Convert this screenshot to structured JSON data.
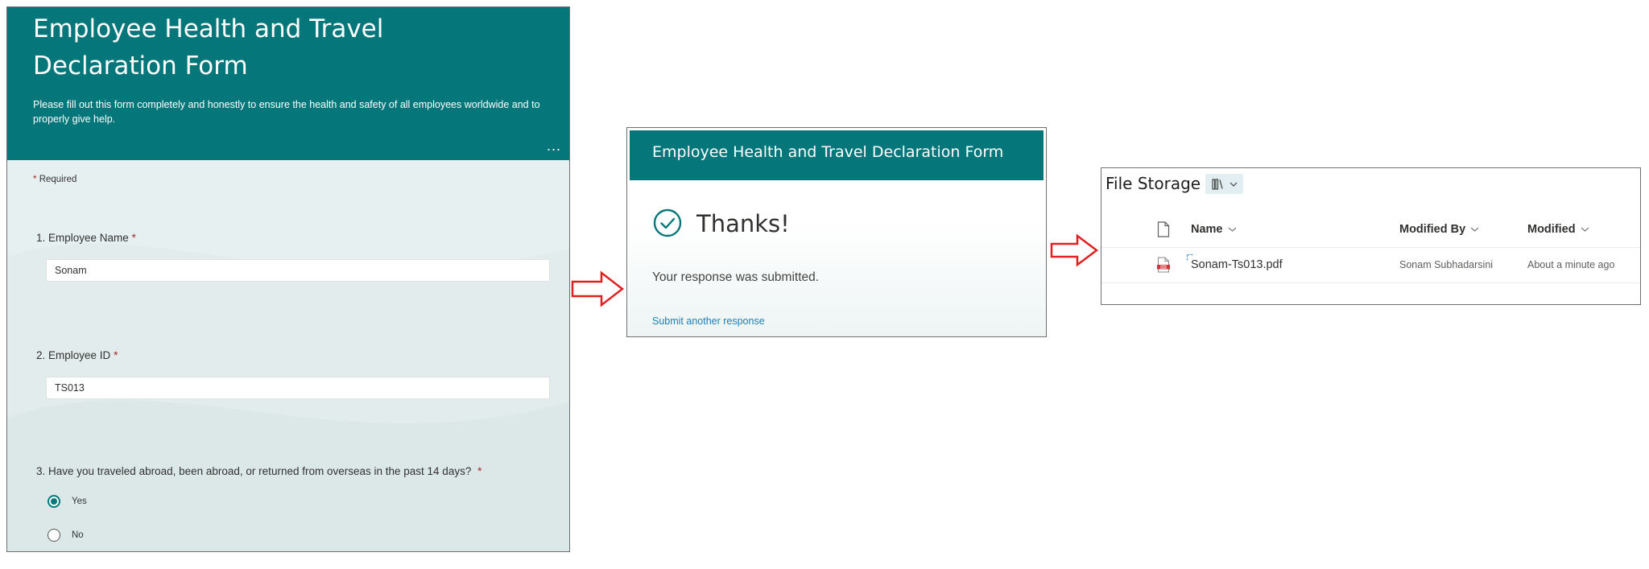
{
  "form": {
    "title": "Employee Health and Travel Declaration Form",
    "description": "Please fill out this form completely and honestly to ensure the health and safety of all employees worldwide and to properly give help.",
    "more_glyph": "...",
    "required_star": "*",
    "required_label": "Required",
    "questions": [
      {
        "label": "1. Employee Name",
        "value": "Sonam"
      },
      {
        "label": "2. Employee ID",
        "value": "TS013"
      },
      {
        "label": "3. Have you traveled abroad, been abroad, or returned from overseas in the past 14 days?",
        "options": [
          "Yes",
          "No"
        ],
        "selected": "Yes"
      }
    ]
  },
  "thanks": {
    "header_title": "Employee Health and Travel Declaration Form",
    "heading": "Thanks!",
    "message": "Your response was submitted.",
    "link": "Submit another response"
  },
  "files": {
    "title": "File Storage",
    "columns": {
      "name": "Name",
      "modified_by": "Modified By",
      "modified": "Modified"
    },
    "rows": [
      {
        "name": "Sonam-Ts013.pdf",
        "modified_by": "Sonam Subhadarsini",
        "modified": "About a minute ago"
      }
    ]
  },
  "colors": {
    "teal": "#05777a",
    "required_red": "#a4262c",
    "link_blue": "#1c7fb5",
    "arrow_red": "#e02020"
  },
  "icons": [
    "more-icon",
    "check-circle-icon",
    "library-view-icon",
    "chevron-down-icon",
    "file-icon",
    "pdf-file-icon",
    "sync-icon",
    "arrow-right-icon"
  ]
}
